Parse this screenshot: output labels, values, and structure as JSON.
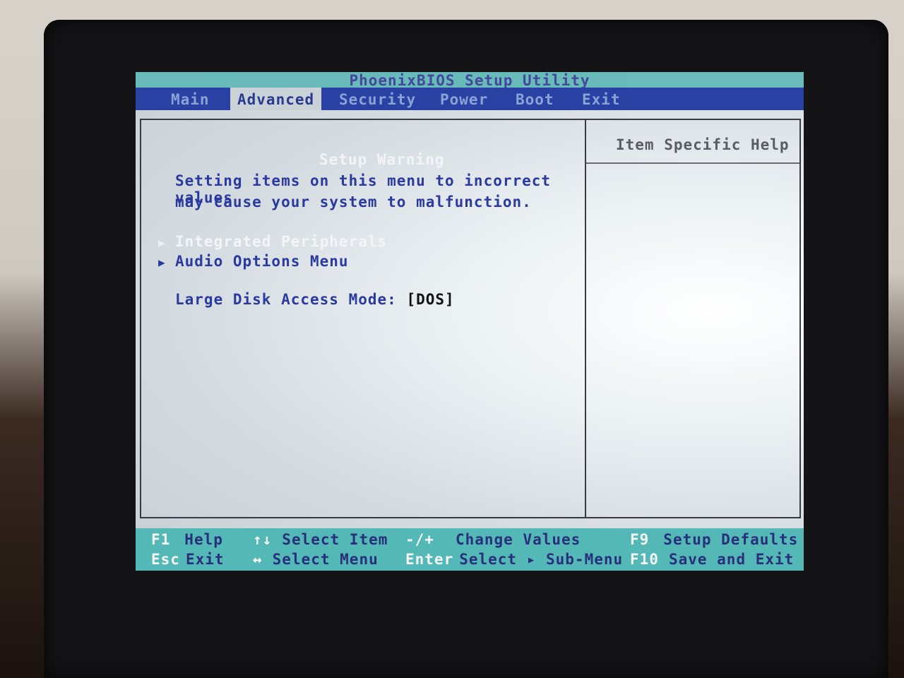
{
  "bios": {
    "title": "PhoenixBIOS Setup Utility",
    "tabs": [
      "Main",
      "Advanced",
      "Security",
      "Power",
      "Boot",
      "Exit"
    ],
    "active_tab": "Advanced"
  },
  "main": {
    "warning_title": "Setup Warning",
    "warning_lines": [
      "Setting items on this menu to incorrect values",
      "may cause your system to malfunction."
    ],
    "submenus": [
      {
        "label": "Integrated Peripherals",
        "selected": true
      },
      {
        "label": "Audio Options Menu",
        "selected": false
      }
    ],
    "settings": [
      {
        "label": "Large Disk Access Mode:",
        "value": "[DOS]"
      }
    ]
  },
  "help": {
    "title": "Item Specific Help"
  },
  "footer": {
    "keys": [
      {
        "key": "F1",
        "desc": "Help"
      },
      {
        "key": "↑↓",
        "desc": "Select Item"
      },
      {
        "key": "-/+",
        "desc": "Change Values"
      },
      {
        "key": "F9",
        "desc": "Setup Defaults"
      },
      {
        "key": "Esc",
        "desc": "Exit"
      },
      {
        "key": "↔",
        "desc": "Select Menu"
      },
      {
        "key": "Enter",
        "desc": "Select ▸ Sub-Menu"
      },
      {
        "key": "F10",
        "desc": "Save and Exit"
      }
    ]
  },
  "colors": {
    "title_bar": "#57b6b5",
    "menu_bar": "#2a41a4",
    "panel_bg": "#d6dde2",
    "text_blue": "#2a3a9e",
    "footer_bg": "#54b8b6"
  }
}
